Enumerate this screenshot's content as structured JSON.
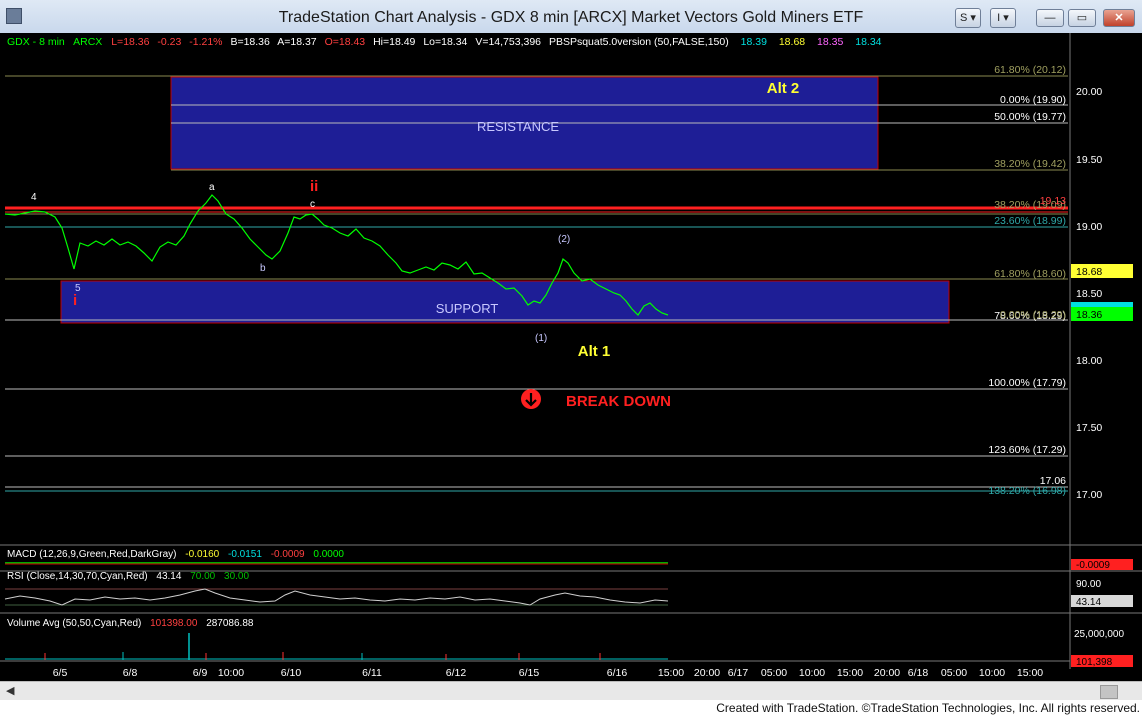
{
  "window": {
    "title": "TradeStation Chart Analysis - GDX 8 min [ARCX] Market Vectors Gold Miners ETF",
    "btn_s": "S ▾",
    "btn_i": "I ▾",
    "minimize_glyph": "—",
    "maximize_glyph": "▭",
    "close_glyph": "✕"
  },
  "header": {
    "symbol": "GDX - 8 min",
    "exchange": "ARCX",
    "last": "L=18.36",
    "change": "-0.23",
    "change_pct": "-1.21%",
    "bid": "B=18.36",
    "ask": "A=18.37",
    "open": "O=18.43",
    "high": "Hi=18.49",
    "low": "Lo=18.34",
    "volume": "V=14,753,396",
    "study": "PBSPsquat5.0version (50,FALSE,150)",
    "study_values": [
      "18.39",
      "18.68",
      "18.35",
      "18.34"
    ]
  },
  "price_axis": {
    "labels": [
      "20.00",
      "19.50",
      "19.00",
      "18.50",
      "18.00",
      "17.50",
      "17.00"
    ],
    "markers": {
      "upper": "18.68",
      "lower": "18.36"
    }
  },
  "fib_levels": [
    "61.80% (20.12)",
    "0.00% (19.90)",
    "50.00% (19.77)",
    "38.20% (19.42)",
    "38.20% (19.09)",
    "23.60% (18.99)",
    "61.80% (18.60)",
    "78.60% (18.29)",
    "100.00% (17.79)",
    "123.60% (17.29)",
    "138.20% (16.98)"
  ],
  "fib_overlap": "0.00% (18.29)",
  "price_marks": {
    "r1913": "19.13",
    "r1706": "17.06"
  },
  "annotations": {
    "resistance": "RESISTANCE",
    "support": "SUPPORT",
    "alt1": "Alt 1",
    "alt2": "Alt 2",
    "breakdown": "BREAK DOWN",
    "w4": "4",
    "w5": "5",
    "wi": "i",
    "wii": "ii",
    "wa": "a",
    "wb": "b",
    "wc": "c",
    "w1": "(1)",
    "w2": "(2)"
  },
  "macd": {
    "label": "MACD (12,26,9,Green,Red,DarkGray)",
    "v1": "-0.0160",
    "v2": "-0.0151",
    "v3": "-0.0009",
    "v4": "0.0000",
    "axis_marker": "-0.0009"
  },
  "rsi": {
    "label": "RSI (Close,14,30,70,Cyan,Red)",
    "v1": "43.14",
    "v2": "70.00",
    "v3": "30.00",
    "axis_label": "90.00",
    "axis_marker": "43.14"
  },
  "volume": {
    "label": "Volume Avg (50,50,Cyan,Red)",
    "v1": "101398.00",
    "v2": "287086.88",
    "axis_label": "25,000,000",
    "axis_marker": "101,398"
  },
  "time_axis": [
    "6/5",
    "6/8",
    "6/9",
    "10:00",
    "6/10",
    "6/11",
    "6/12",
    "6/15",
    "6/16",
    "15:00",
    "20:00",
    "6/17",
    "05:00",
    "10:00",
    "15:00",
    "20:00",
    "6/18",
    "05:00",
    "10:00",
    "15:00"
  ],
  "footer": "Created with TradeStation. ©TradeStation Technologies, Inc. All rights reserved.",
  "colors": {
    "box": "#1e1e96",
    "box_border": "#c00000",
    "red_line": "#ff2020",
    "price": "#00ff00",
    "text_yellow": "#ffff33",
    "breakdown": "#ff2020"
  }
}
